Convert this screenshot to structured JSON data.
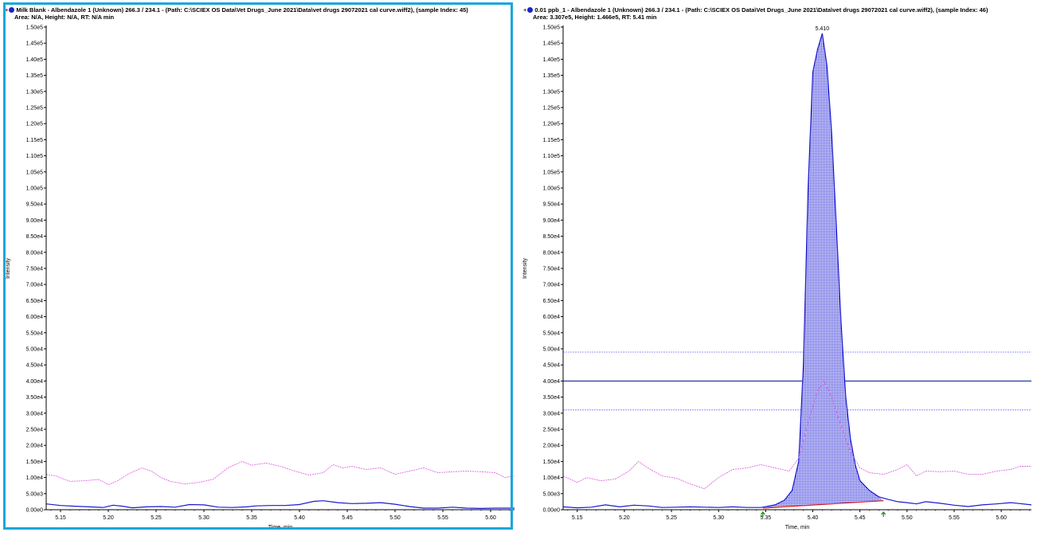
{
  "chart_data": [
    {
      "type": "line",
      "title": "Milk Blank - Albendazole 1 (Unknown) 266.3 / 234.1 - (Path: C:\\SCIEX OS Data\\Vet Drugs_June 2021\\Data\\vet drugs 29072021 cal curve.wiff2), (sample Index: 45)",
      "subtitle": "Area: N/A, Height: N/A, RT: N/A min",
      "xlabel": "Time, min",
      "ylabel": "Intensity",
      "xlim": [
        5.135,
        5.625
      ],
      "ylim": [
        0,
        150000
      ],
      "x_ticks": [
        "5.15",
        "5.20",
        "5.25",
        "5.30",
        "5.35",
        "5.40",
        "5.45",
        "5.50",
        "5.55",
        "5.60"
      ],
      "x_tick_values": [
        5.15,
        5.2,
        5.25,
        5.3,
        5.35,
        5.4,
        5.45,
        5.5,
        5.55,
        5.6
      ],
      "y_ticks": [
        "0.00e0",
        "5.00e3",
        "1.00e4",
        "1.50e4",
        "2.00e4",
        "2.50e4",
        "3.00e4",
        "3.50e4",
        "4.00e4",
        "4.50e4",
        "5.00e4",
        "5.50e4",
        "6.00e4",
        "6.50e4",
        "7.00e4",
        "7.50e4",
        "8.00e4",
        "8.50e4",
        "9.00e4",
        "9.50e4",
        "1.00e5",
        "1.05e5",
        "1.10e5",
        "1.15e5",
        "1.20e5",
        "1.25e5",
        "1.30e5",
        "1.35e5",
        "1.40e5",
        "1.45e5",
        "1.50e5"
      ],
      "selected": true,
      "series": [
        {
          "color": "#1a1acc",
          "style": "solid",
          "x": [
            5.135,
            5.15,
            5.165,
            5.18,
            5.195,
            5.205,
            5.215,
            5.225,
            5.24,
            5.255,
            5.27,
            5.285,
            5.3,
            5.315,
            5.33,
            5.345,
            5.355,
            5.37,
            5.385,
            5.4,
            5.415,
            5.425,
            5.44,
            5.455,
            5.47,
            5.485,
            5.5,
            5.515,
            5.53,
            5.545,
            5.56,
            5.575,
            5.59,
            5.605,
            5.625
          ],
          "y": [
            1800,
            1300,
            1100,
            900,
            700,
            1400,
            1100,
            600,
            900,
            1000,
            800,
            1600,
            1500,
            800,
            700,
            900,
            1200,
            1300,
            1300,
            1600,
            2600,
            2800,
            2200,
            1900,
            2000,
            2200,
            1700,
            1000,
            500,
            500,
            800,
            500,
            400,
            500,
            500
          ]
        },
        {
          "color": "#e066e0",
          "style": "dashed",
          "x": [
            5.135,
            5.145,
            5.16,
            5.175,
            5.19,
            5.2,
            5.21,
            5.22,
            5.235,
            5.245,
            5.255,
            5.265,
            5.28,
            5.295,
            5.31,
            5.325,
            5.34,
            5.35,
            5.365,
            5.38,
            5.395,
            5.41,
            5.425,
            5.435,
            5.445,
            5.455,
            5.47,
            5.485,
            5.5,
            5.515,
            5.53,
            5.545,
            5.56,
            5.575,
            5.59,
            5.605,
            5.615,
            5.625
          ],
          "y": [
            11000,
            10500,
            8800,
            9000,
            9400,
            7800,
            9000,
            11000,
            13000,
            12000,
            10000,
            8800,
            8000,
            8500,
            9500,
            13000,
            15000,
            13800,
            14500,
            13500,
            12000,
            10800,
            11500,
            14000,
            13000,
            13500,
            12500,
            13000,
            11000,
            12000,
            13000,
            11500,
            11800,
            12000,
            11800,
            11500,
            10000,
            10500
          ]
        }
      ]
    },
    {
      "type": "line",
      "title": "0.01 ppb_1 - Albendazole 1 (Unknown) 266.3 / 234.1 - (Path: C:\\SCIEX OS Data\\Vet Drugs_June 2021\\Data\\vet drugs 29072021 cal curve.wiff2), (sample Index: 46)",
      "subtitle": "Area: 3.307e5, Height: 1.466e5, RT: 5.41 min",
      "xlabel": "Time, min",
      "ylabel": "Intensity",
      "xlim": [
        5.135,
        5.632
      ],
      "ylim": [
        0,
        150000
      ],
      "x_ticks": [
        "5.15",
        "5.20",
        "5.25",
        "5.30",
        "5.35",
        "5.40",
        "5.45",
        "5.50",
        "5.55",
        "5.60"
      ],
      "x_tick_values": [
        5.15,
        5.2,
        5.25,
        5.3,
        5.35,
        5.4,
        5.45,
        5.5,
        5.55,
        5.6
      ],
      "y_ticks": [
        "0.00e0",
        "5.00e3",
        "1.00e4",
        "1.50e4",
        "2.00e4",
        "2.50e4",
        "3.00e4",
        "3.50e4",
        "4.00e4",
        "4.50e4",
        "5.00e4",
        "5.50e4",
        "6.00e4",
        "6.50e4",
        "7.00e4",
        "7.50e4",
        "8.00e4",
        "8.50e4",
        "9.00e4",
        "9.50e4",
        "1.00e5",
        "1.05e5",
        "1.10e5",
        "1.15e5",
        "1.20e5",
        "1.25e5",
        "1.30e5",
        "1.35e5",
        "1.40e5",
        "1.45e5",
        "1.50e5"
      ],
      "selected": false,
      "peak_label": "5.410",
      "peak_x": 5.41,
      "peak_y": 148000,
      "integration": {
        "start_x": 5.347,
        "end_x": 5.475,
        "start_y": 500,
        "end_y": 2800,
        "fill": "#3333dd",
        "baseline_color": "#e02020"
      },
      "marker_color": "#2a8a2a",
      "hlines": [
        {
          "y": 49000,
          "color": "#8888ff",
          "style": "dashed"
        },
        {
          "y": 40000,
          "color": "#3344aa",
          "style": "solid"
        },
        {
          "y": 31000,
          "color": "#8888ff",
          "style": "dashed"
        }
      ],
      "series": [
        {
          "color": "#1a1acc",
          "style": "solid",
          "x": [
            5.135,
            5.15,
            5.165,
            5.18,
            5.195,
            5.21,
            5.225,
            5.24,
            5.255,
            5.27,
            5.285,
            5.3,
            5.315,
            5.33,
            5.345,
            5.36,
            5.37,
            5.378,
            5.385,
            5.39,
            5.395,
            5.4,
            5.405,
            5.41,
            5.415,
            5.42,
            5.425,
            5.43,
            5.435,
            5.44,
            5.445,
            5.45,
            5.46,
            5.47,
            5.48,
            5.49,
            5.5,
            5.51,
            5.52,
            5.535,
            5.55,
            5.565,
            5.58,
            5.595,
            5.61,
            5.632
          ],
          "y": [
            900,
            600,
            800,
            1500,
            900,
            1400,
            1200,
            700,
            800,
            900,
            800,
            700,
            900,
            700,
            700,
            1500,
            3000,
            6000,
            15000,
            45000,
            100000,
            136000,
            143000,
            148000,
            138000,
            117000,
            88000,
            58000,
            35000,
            22000,
            14000,
            9000,
            6000,
            4000,
            3200,
            2500,
            2200,
            1800,
            2500,
            2000,
            1400,
            1000,
            1500,
            1800,
            2200,
            1500
          ]
        },
        {
          "color": "#e066e0",
          "style": "dashed",
          "x": [
            5.135,
            5.15,
            5.16,
            5.175,
            5.19,
            5.205,
            5.215,
            5.225,
            5.24,
            5.255,
            5.27,
            5.285,
            5.3,
            5.315,
            5.33,
            5.345,
            5.36,
            5.375,
            5.385,
            5.395,
            5.405,
            5.412,
            5.42,
            5.43,
            5.44,
            5.45,
            5.46,
            5.475,
            5.49,
            5.5,
            5.51,
            5.52,
            5.535,
            5.55,
            5.565,
            5.58,
            5.595,
            5.61,
            5.62,
            5.632
          ],
          "y": [
            10500,
            8500,
            10000,
            9000,
            9500,
            12000,
            15000,
            13000,
            10500,
            9800,
            8000,
            6500,
            10000,
            12500,
            13000,
            14000,
            13000,
            12000,
            16000,
            27000,
            37000,
            40000,
            35000,
            26000,
            18000,
            13000,
            11500,
            11000,
            12500,
            14000,
            10500,
            12000,
            11800,
            12000,
            11000,
            11000,
            12000,
            12500,
            13500,
            13500
          ]
        }
      ]
    }
  ]
}
